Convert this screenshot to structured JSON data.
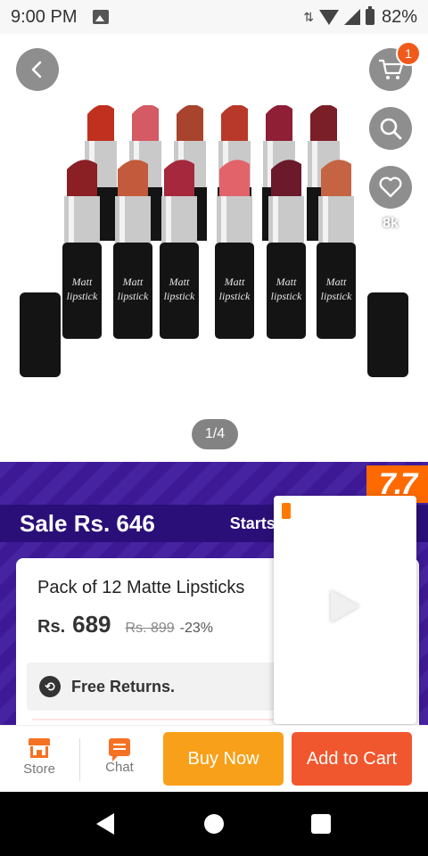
{
  "status_bar": {
    "time": "9:00 PM",
    "battery": "82%",
    "network_arrows": "⇅"
  },
  "top_actions": {
    "cart_badge": "1",
    "likes_count": "8k"
  },
  "gallery": {
    "counter": "1/4"
  },
  "lipstick_label": "Matt lipstick",
  "promo": {
    "campaign_logo": "7.7",
    "sale_price": "Sale Rs. 646",
    "starts_text": "Starts"
  },
  "product": {
    "title": "Pack of 12 Matte Lipsticks",
    "currency": "Rs.",
    "price": "689",
    "original_price": "Rs. 899",
    "discount": "-23%"
  },
  "service": {
    "free_returns": "Free Returns."
  },
  "bottom_bar": {
    "store_label": "Store",
    "chat_label": "Chat",
    "buy_now_label": "Buy Now",
    "add_to_cart_label": "Add to Cart"
  },
  "colors": {
    "promo_bg": "#3f1a9c",
    "sale_strip": "#2b0f78",
    "accent_orange": "#f57224",
    "buy_now": "#f9a01a",
    "add_to_cart": "#f1572e"
  },
  "lipsticks": [
    {
      "color": "#c0301f"
    },
    {
      "color": "#d45a63"
    },
    {
      "color": "#a8432d"
    },
    {
      "color": "#b8392a"
    },
    {
      "color": "#8e1f34"
    },
    {
      "color": "#7a1f27"
    },
    {
      "color": "#8a1f24"
    },
    {
      "color": "#c25a3b"
    },
    {
      "color": "#a5283c"
    },
    {
      "color": "#e2646a"
    },
    {
      "color": "#6a1a2a"
    },
    {
      "color": "#c46443"
    }
  ]
}
